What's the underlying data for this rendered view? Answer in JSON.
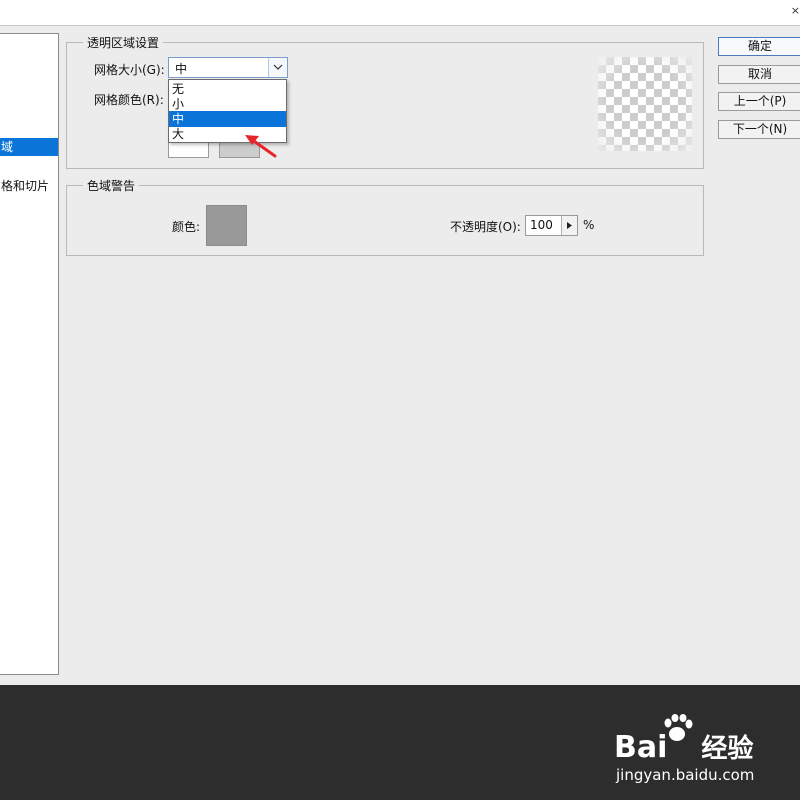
{
  "topbar": {
    "close_glyph": "×"
  },
  "left_list": {
    "items": [
      {
        "label": "域",
        "selected": true
      },
      {
        "label": "格和切片",
        "selected": false
      }
    ]
  },
  "transparency": {
    "legend": "透明区域设置",
    "grid_size_label": "网格大小(G):",
    "grid_size_value": "中",
    "grid_color_label": "网格颜色(R):",
    "dropdown_options": [
      "无",
      "小",
      "中",
      "大"
    ],
    "selected_option": "中",
    "swatch_colors": [
      "#ffffff",
      "#cccccc"
    ]
  },
  "gamut": {
    "legend": "色域警告",
    "color_label": "颜色:",
    "swatch_color": "#999999",
    "opacity_label": "不透明度(O):",
    "opacity_value": "100",
    "opacity_unit": "%"
  },
  "buttons": {
    "ok": "确定",
    "cancel": "取消",
    "prev": "上一个(P)",
    "next": "下一个(N)"
  },
  "colors": {
    "accent": "#0a74d8",
    "annotation_arrow": "#e8262a"
  },
  "watermark": {
    "logo": "Bai",
    "logo_suffix": "经验",
    "subtitle": "jingyan.baidu.com"
  }
}
